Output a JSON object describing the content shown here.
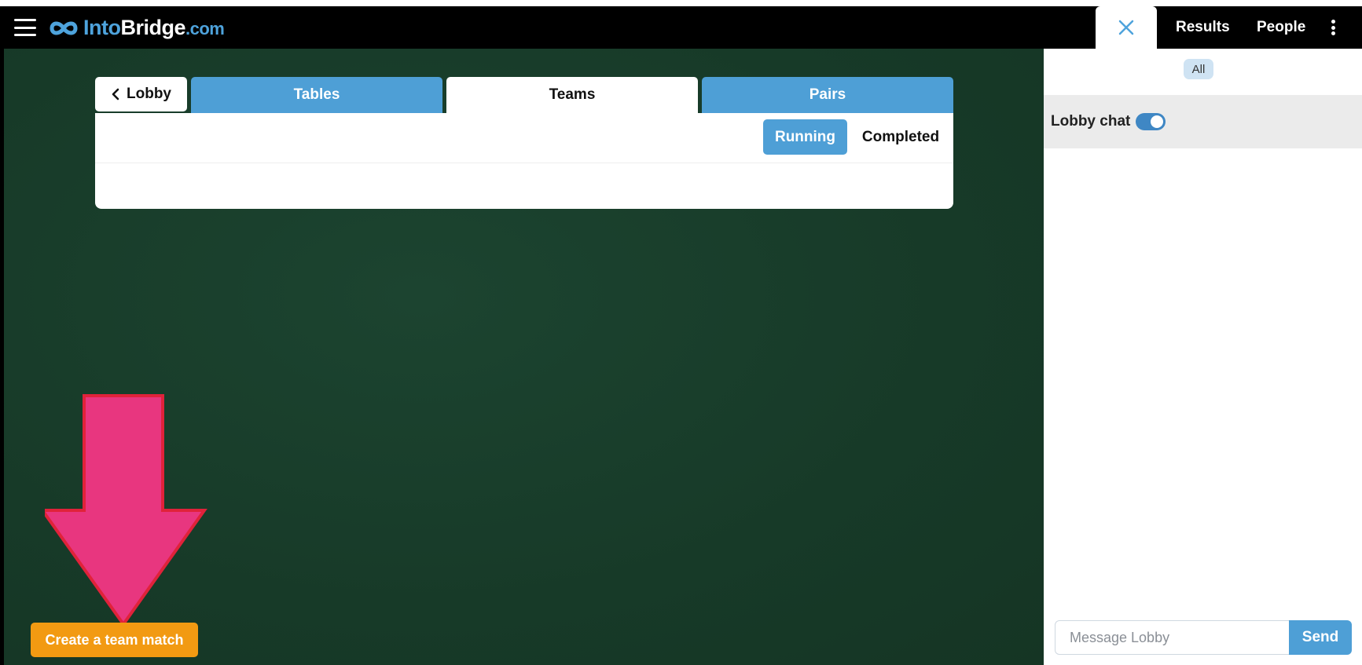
{
  "header": {
    "logo_into": "Into",
    "logo_bridge": "Bridge",
    "logo_com": ".com",
    "nav": {
      "results": "Results",
      "people": "People"
    }
  },
  "lobby_tabs": {
    "lobby": "Lobby",
    "tables": "Tables",
    "teams": "Teams",
    "pairs": "Pairs",
    "active": "Teams"
  },
  "filters": {
    "running": "Running",
    "completed": "Completed",
    "active": "Running"
  },
  "actions": {
    "create_team_match": "Create a team match"
  },
  "chat": {
    "filter_all": "All",
    "lobby_chat_label": "Lobby chat",
    "lobby_chat_enabled": true,
    "message_placeholder": "Message Lobby",
    "send_label": "Send"
  },
  "colors": {
    "accent_blue": "#4e9fd6",
    "table_green": "#173a28",
    "create_orange": "#f29a12",
    "annotation_arrow": "#e8367f"
  },
  "icons": [
    "menu-icon",
    "infinity-logo-icon",
    "close-icon",
    "more-vertical-icon",
    "chevron-left-icon",
    "arrow-down-annotation"
  ]
}
